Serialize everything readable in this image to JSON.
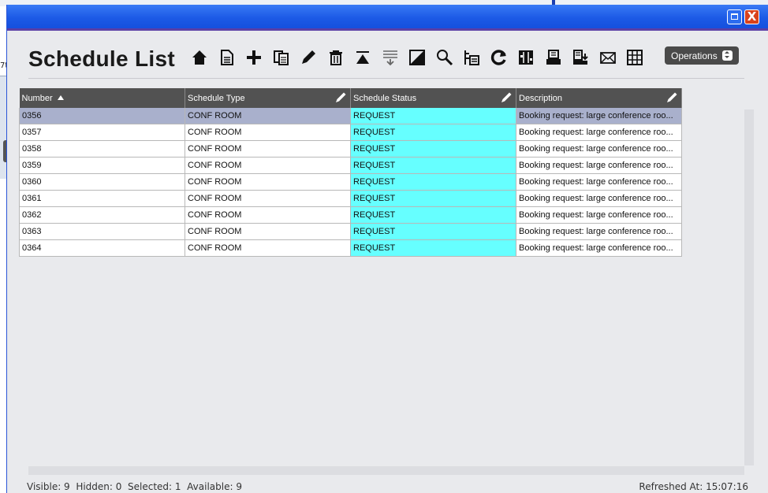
{
  "background": {
    "left_fragment": "7t"
  },
  "window": {
    "title": "",
    "maximize_label": "",
    "close_label": "X"
  },
  "header": {
    "title": "Schedule List",
    "operations_label": "Operations"
  },
  "toolbar": {
    "icons": [
      "home-icon",
      "new-document-icon",
      "add-icon",
      "copy-icon",
      "edit-icon",
      "delete-icon",
      "move-top-icon",
      "filter-icon",
      "toggle-icon",
      "search-icon",
      "hierarchy-icon",
      "refresh-icon",
      "columns-icon",
      "print-icon",
      "export-icon",
      "email-icon",
      "grid-icon"
    ]
  },
  "table": {
    "columns": [
      {
        "label": "Number",
        "sort": "ascending",
        "editable": false
      },
      {
        "label": "Schedule Type",
        "editable": true
      },
      {
        "label": "Schedule Status",
        "editable": true
      },
      {
        "label": "Description",
        "editable": true
      }
    ],
    "rows": [
      {
        "number": "0356",
        "type": "CONF ROOM",
        "status": "REQUEST",
        "description": "Booking request: large conference roo...",
        "selected": true
      },
      {
        "number": "0357",
        "type": "CONF ROOM",
        "status": "REQUEST",
        "description": "Booking request: large conference roo..."
      },
      {
        "number": "0358",
        "type": "CONF ROOM",
        "status": "REQUEST",
        "description": "Booking request: large conference roo..."
      },
      {
        "number": "0359",
        "type": "CONF ROOM",
        "status": "REQUEST",
        "description": "Booking request: large conference roo..."
      },
      {
        "number": "0360",
        "type": "CONF ROOM",
        "status": "REQUEST",
        "description": "Booking request: large conference roo..."
      },
      {
        "number": "0361",
        "type": "CONF ROOM",
        "status": "REQUEST",
        "description": "Booking request: large conference roo..."
      },
      {
        "number": "0362",
        "type": "CONF ROOM",
        "status": "REQUEST",
        "description": "Booking request: large conference roo..."
      },
      {
        "number": "0363",
        "type": "CONF ROOM",
        "status": "REQUEST",
        "description": "Booking request: large conference roo..."
      },
      {
        "number": "0364",
        "type": "CONF ROOM",
        "status": "REQUEST",
        "description": "Booking request: large conference roo..."
      }
    ]
  },
  "status_bar": {
    "left": "Visible: 9  Hidden: 0  Selected: 1  Available: 9",
    "right": "Refreshed At: 15:07:16"
  },
  "colors": {
    "titlebar": "#1c5ae6",
    "status_cell": "#66ffff",
    "selected_row": "#a9b0cc",
    "header_bg": "#525252"
  }
}
